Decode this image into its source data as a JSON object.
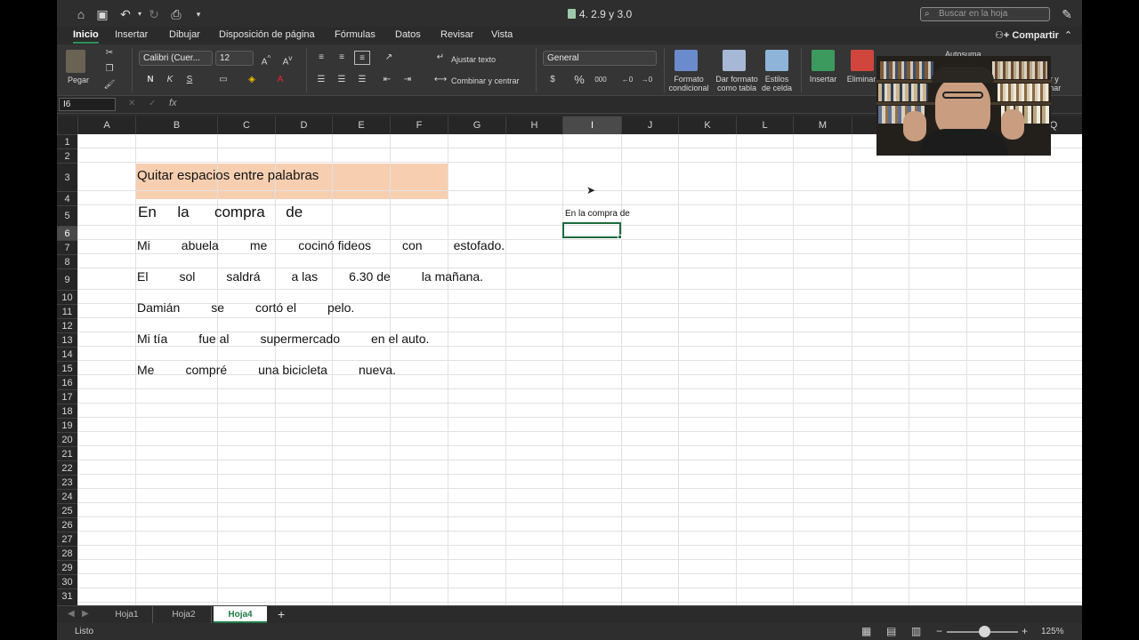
{
  "window": {
    "title": "4. 2.9 y 3.0",
    "search_placeholder": "Buscar en la hoja"
  },
  "tabs": [
    "Inicio",
    "Insertar",
    "Dibujar",
    "Disposición de página",
    "Fórmulas",
    "Datos",
    "Revisar",
    "Vista"
  ],
  "share_label": "Compartir",
  "ribbon": {
    "paste_label": "Pegar",
    "font_name": "Calibri (Cuer...",
    "font_size": "12",
    "bold": "N",
    "italic": "K",
    "underline": "S",
    "wrap_text": "Ajustar texto",
    "merge_center": "Combinar y centrar",
    "number_format": "General",
    "currency": "$",
    "percent": "%",
    "thousands": "000",
    "cond_format": "Formato\ncondicional",
    "format_table": "Dar formato\ncomo tabla",
    "cell_styles": "Estilos\nde celda",
    "insert": "Insertar",
    "delete": "Eliminar",
    "autosum": "Autosuma",
    "find_select": "car y\ncionar"
  },
  "formula_bar": {
    "name_box": "I6",
    "fx": "fx",
    "content": ""
  },
  "columns": [
    "A",
    "B",
    "C",
    "D",
    "E",
    "F",
    "G",
    "H",
    "I",
    "J",
    "K",
    "L",
    "M",
    "N",
    "O",
    "P",
    "Q"
  ],
  "selected_column": "I",
  "rows": [
    "1",
    "2",
    "3",
    "4",
    "5",
    "6",
    "7",
    "8",
    "9",
    "10",
    "11",
    "12",
    "13",
    "14",
    "15",
    "16",
    "17",
    "18",
    "19",
    "20",
    "21",
    "22",
    "23",
    "24",
    "25",
    "26",
    "27",
    "28",
    "29",
    "30",
    "31"
  ],
  "selected_row": "6",
  "cells": {
    "b3": "Quitar espacios entre palabras",
    "b5": "En     la      compra     de",
    "i5": "En la compra de",
    "b7": "Mi         abuela         me         cocinó fideos         con         estofado.",
    "b9": "El         sol         saldrá         a las         6.30 de         la mañana.",
    "b11": "Damián         se         cortó el         pelo.",
    "b13": "Mi tía         fue al         supermercado         en el auto.",
    "b15": "Me         compré         una bicicleta         nueva."
  },
  "sheets": [
    "Hoja1",
    "Hoja2",
    "Hoja4"
  ],
  "active_sheet": "Hoja4",
  "status": {
    "ready": "Listo",
    "zoom": "125%"
  },
  "colors": {
    "accent": "#1f7a45",
    "title_fill": "#f7cfb0"
  }
}
